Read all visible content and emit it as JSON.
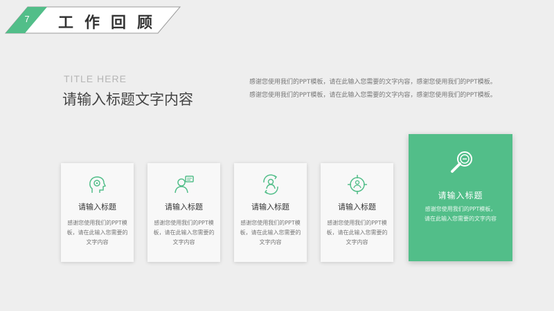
{
  "header": {
    "slide_number": "7",
    "section_title": "工作回顾"
  },
  "heading": {
    "eyebrow": "TITLE HERE",
    "title": "请输入标题文字内容"
  },
  "intro_text": "感谢您使用我们的PPT模板，请在此输入您需要的文字内容，感谢您使用我们的PPT模板。感谢您使用我们的PPT模板，请在此输入您需要的文字内容，感谢您使用我们的PPT模板。",
  "cards": [
    {
      "icon": "head-gear-icon",
      "title": "请输入标题",
      "text": "感谢您使用我们的PPT模板，请在此输入您需要的文字内容"
    },
    {
      "icon": "person-chat-icon",
      "title": "请输入标题",
      "text": "感谢您使用我们的PPT模板，请在此输入您需要的文字内容"
    },
    {
      "icon": "people-exchange-icon",
      "title": "请输入标题",
      "text": "感谢您使用我们的PPT模板，请在此输入您需要的文字内容"
    },
    {
      "icon": "target-person-icon",
      "title": "请输入标题",
      "text": "感谢您使用我们的PPT模板，请在此输入您需要的文字内容"
    }
  ],
  "highlight_card": {
    "icon": "magnifier-icon",
    "title": "请输入标题",
    "text": "感谢您使用我们的PPT模板，请在此输入您需要的文字内容"
  },
  "colors": {
    "accent": "#52be89",
    "background": "#eeeeee",
    "card": "#f8f8f8"
  }
}
